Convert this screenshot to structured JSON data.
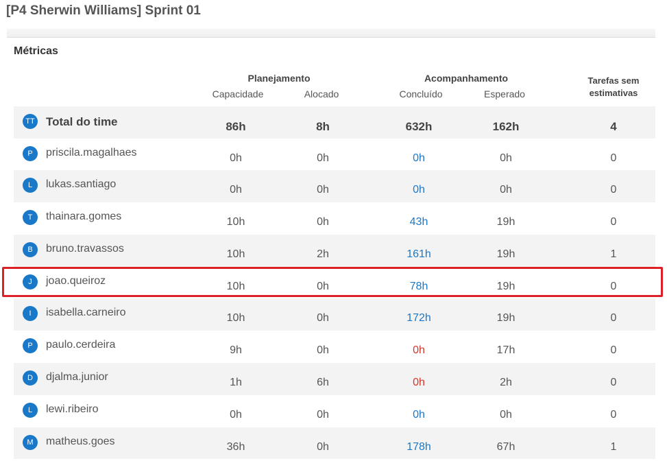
{
  "page": {
    "title": "[P4 Sherwin Williams] Sprint 01"
  },
  "section": {
    "title": "Métricas"
  },
  "headers": {
    "planejamento": "Planejamento",
    "acompanhamento": "Acompanhamento",
    "capacidade": "Capacidade",
    "alocado": "Alocado",
    "concluido": "Concluído",
    "esperado": "Esperado",
    "tarefas_sem_estimativas_line1": "Tarefas sem",
    "tarefas_sem_estimativas_line2": "estimativas"
  },
  "colors": {
    "avatar": "#1a78c8",
    "link_blue": "#1a78c8",
    "alert_red": "#d0372b",
    "highlight": "#dd1f26"
  },
  "total": {
    "avatar": "TT",
    "name": "Total do time",
    "capacidade": "86h",
    "alocado": "8h",
    "concluido": "632h",
    "esperado": "162h",
    "tarefas": "4"
  },
  "members": [
    {
      "avatar": "P",
      "name": "priscila.magalhaes",
      "capacidade": "0h",
      "alocado": "0h",
      "concluido": "0h",
      "concluido_status": "blue",
      "esperado": "0h",
      "tarefas": "0"
    },
    {
      "avatar": "L",
      "name": "lukas.santiago",
      "capacidade": "0h",
      "alocado": "0h",
      "concluido": "0h",
      "concluido_status": "blue",
      "esperado": "0h",
      "tarefas": "0"
    },
    {
      "avatar": "T",
      "name": "thainara.gomes",
      "capacidade": "10h",
      "alocado": "0h",
      "concluido": "43h",
      "concluido_status": "blue",
      "esperado": "19h",
      "tarefas": "0"
    },
    {
      "avatar": "B",
      "name": "bruno.travassos",
      "capacidade": "10h",
      "alocado": "2h",
      "concluido": "161h",
      "concluido_status": "blue",
      "esperado": "19h",
      "tarefas": "1"
    },
    {
      "avatar": "J",
      "name": "joao.queiroz",
      "capacidade": "10h",
      "alocado": "0h",
      "concluido": "78h",
      "concluido_status": "blue",
      "esperado": "19h",
      "tarefas": "0"
    },
    {
      "avatar": "I",
      "name": "isabella.carneiro",
      "capacidade": "10h",
      "alocado": "0h",
      "concluido": "172h",
      "concluido_status": "blue",
      "esperado": "19h",
      "tarefas": "0"
    },
    {
      "avatar": "P",
      "name": "paulo.cerdeira",
      "capacidade": "9h",
      "alocado": "0h",
      "concluido": "0h",
      "concluido_status": "red",
      "esperado": "17h",
      "tarefas": "0"
    },
    {
      "avatar": "D",
      "name": "djalma.junior",
      "capacidade": "1h",
      "alocado": "6h",
      "concluido": "0h",
      "concluido_status": "red",
      "esperado": "2h",
      "tarefas": "0"
    },
    {
      "avatar": "L",
      "name": "lewi.ribeiro",
      "capacidade": "0h",
      "alocado": "0h",
      "concluido": "0h",
      "concluido_status": "blue",
      "esperado": "0h",
      "tarefas": "0"
    },
    {
      "avatar": "M",
      "name": "matheus.goes",
      "capacidade": "36h",
      "alocado": "0h",
      "concluido": "178h",
      "concluido_status": "blue",
      "esperado": "67h",
      "tarefas": "1"
    }
  ]
}
